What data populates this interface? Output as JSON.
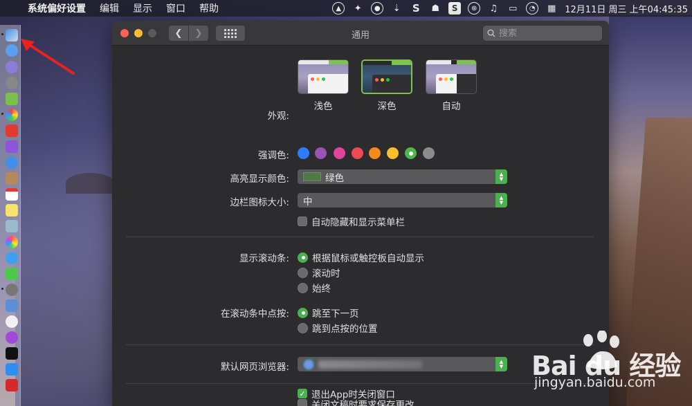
{
  "menubar": {
    "apple": "",
    "app_name": "系统偏好设置",
    "menus": [
      "编辑",
      "显示",
      "窗口",
      "帮助"
    ],
    "clock": "12月11日 周三 上午04:45:35",
    "status_icons": [
      "navigation-icon",
      "fox-icon",
      "sync-icon",
      "download-icon",
      "s-icon",
      "ghost-icon",
      "sougou-icon",
      "globe-icon",
      "music-icon",
      "screen-share-icon",
      "speedometer-icon",
      "calendar-icon"
    ]
  },
  "window": {
    "title": "通用",
    "search_placeholder": "搜索"
  },
  "appearance": {
    "label": "外观:",
    "options": [
      {
        "name": "浅色",
        "selected": false
      },
      {
        "name": "深色",
        "selected": true
      },
      {
        "name": "自动",
        "selected": false
      }
    ]
  },
  "accent": {
    "label": "强调色:",
    "colors": [
      "#2b7cf6",
      "#9a52b5",
      "#e1449b",
      "#ec4a55",
      "#f28a1d",
      "#f8be2b",
      "#4cb84c",
      "#8c8c8c"
    ],
    "selected_index": 6
  },
  "highlight": {
    "label": "高亮显示颜色:",
    "value": "绿色"
  },
  "sidebar_size": {
    "label": "边栏图标大小:",
    "value": "中"
  },
  "auto_hide_menubar": {
    "label": "自动隐藏和显示菜单栏",
    "checked": false
  },
  "scrollbars": {
    "label": "显示滚动条:",
    "options": [
      "根据鼠标或触控板自动显示",
      "滚动时",
      "始终"
    ],
    "selected_index": 0
  },
  "click_scrollbar": {
    "label": "在滚动条中点按:",
    "options": [
      "跳至下一页",
      "跳到点按的位置"
    ],
    "selected_index": 0
  },
  "browser": {
    "label": "默认网页浏览器:"
  },
  "close_docs": {
    "label": "关闭文稿时要求保存更改",
    "checked": false
  },
  "close_windows": {
    "label": "退出App时关闭窗口",
    "checked": true
  },
  "watermark": {
    "logo": "Bai du 经验",
    "url": "jingyan.baidu.com"
  }
}
